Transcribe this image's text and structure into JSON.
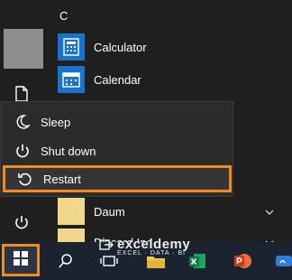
{
  "start_list": {
    "section_letter": "C",
    "apps": [
      {
        "label": "Calculator",
        "icon": "calculator-icon"
      },
      {
        "label": "Calendar",
        "icon": "calendar-icon"
      },
      {
        "label": "Daum",
        "icon": "folder-icon"
      },
      {
        "label": "Discord Inc",
        "icon": "folder-icon"
      }
    ]
  },
  "power_menu": {
    "items": [
      {
        "label": "Sleep",
        "icon": "moon-icon"
      },
      {
        "label": "Shut down",
        "icon": "power-icon"
      },
      {
        "label": "Restart",
        "icon": "restart-icon"
      }
    ]
  },
  "watermark": {
    "brand": "exceldemy",
    "tagline": "EXCEL · DATA · BI"
  },
  "colors": {
    "highlight": "#f08a24",
    "tile_blue": "#1a73c9",
    "taskbar": "#1b2330"
  }
}
